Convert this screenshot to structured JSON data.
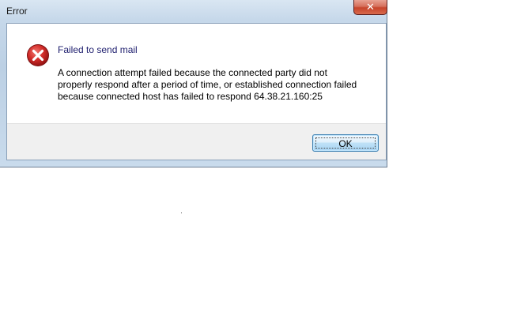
{
  "window": {
    "title": "Error",
    "close_label": "✕"
  },
  "dialog": {
    "icon": "error-icon",
    "heading": "Failed to send mail",
    "message_lines": [
      "A connection attempt failed because the connected party did not",
      "properly respond after a period of time, or established connection failed",
      "because connected host has failed to respond 64.38.21.160:25"
    ],
    "ok_label": "OK"
  },
  "colors": {
    "icon_red": "#c8262b",
    "heading_text": "#1e1e6e",
    "footer_bg": "#f0f0f0",
    "close_button": "#c7442b"
  }
}
